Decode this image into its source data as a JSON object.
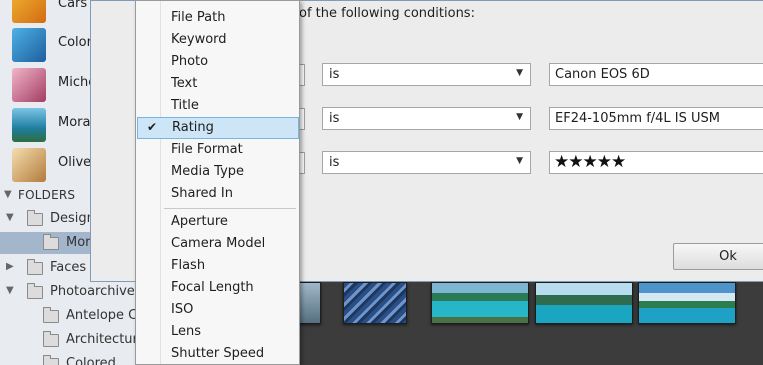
{
  "sidebar": {
    "albums": [
      {
        "label": "Cars",
        "color": "#e8a21c"
      },
      {
        "label": "Colore",
        "color": "#2a7fc4"
      },
      {
        "label": "Miche",
        "color": "#c7567e"
      },
      {
        "label": "Mora",
        "color": "#2c8fb6"
      },
      {
        "label": "Olive",
        "color": "#c99a55"
      }
    ],
    "folders_header": "FOLDERS",
    "tree": [
      {
        "label": "Design",
        "arrow": "▼"
      },
      {
        "label": "Mor",
        "arrow": ""
      },
      {
        "label": "Faces",
        "arrow": "▶"
      },
      {
        "label": "Photoarchive",
        "arrow": "▼"
      },
      {
        "label": "Antelope Ca",
        "arrow": ""
      },
      {
        "label": "Architecture",
        "arrow": ""
      },
      {
        "label": "Colored",
        "arrow": ""
      }
    ]
  },
  "dialog": {
    "conditions_text": "of the following conditions:",
    "rows": [
      {
        "operator": "is",
        "value": "Canon EOS 6D"
      },
      {
        "operator": "is",
        "value": "EF24-105mm f/4L IS USM"
      },
      {
        "operator": "is",
        "value": "★★★★★"
      }
    ],
    "ok_label": "Ok"
  },
  "menu": {
    "group1": [
      "File Path",
      "Keyword",
      "Photo",
      "Text",
      "Title",
      "Rating",
      "File Format",
      "Media Type",
      "Shared In"
    ],
    "group2": [
      "Aperture",
      "Camera Model",
      "Flash",
      "Focal Length",
      "ISO",
      "Lens",
      "Shutter Speed"
    ],
    "checked_item": "Rating",
    "check_mark": "✔"
  },
  "colors": {
    "selection": "#a3b6cc",
    "menu_highlight": "#cde6f7",
    "dialog_bg": "#ececec"
  }
}
